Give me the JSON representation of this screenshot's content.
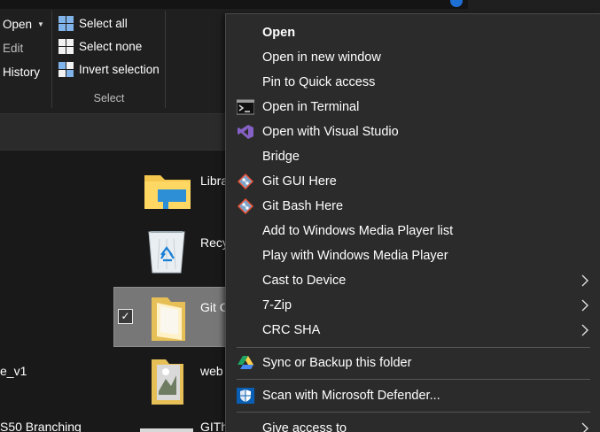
{
  "ribbon": {
    "open_label": "Open",
    "edit_label": "Edit",
    "history_label": "History",
    "select_all_label": "Select all",
    "select_none_label": "Select none",
    "invert_selection_label": "Invert selection",
    "select_group_label": "Select"
  },
  "files": {
    "libraries_label": "Libra",
    "recycle_label": "Recy",
    "git_label": "Git C",
    "web_label": "web",
    "githu_label": "GITh",
    "left_v1_label": "e_v1",
    "left_branching_label": "S50 Branching",
    "git_selected": true
  },
  "context_menu": {
    "items": [
      {
        "label": "Open"
      },
      {
        "label": "Open in new window"
      },
      {
        "label": "Pin to Quick access"
      },
      {
        "label": "Open in Terminal",
        "icon": "terminal-icon"
      },
      {
        "label": "Open with Visual Studio",
        "icon": "visual-studio-icon"
      },
      {
        "label": "Bridge"
      },
      {
        "label": "Git GUI Here",
        "icon": "git-icon"
      },
      {
        "label": "Git Bash Here",
        "icon": "git-icon"
      },
      {
        "label": "Add to Windows Media Player list"
      },
      {
        "label": "Play with Windows Media Player"
      },
      {
        "label": "Cast to Device",
        "submenu": true
      },
      {
        "label": "7-Zip",
        "submenu": true
      },
      {
        "label": "CRC SHA",
        "submenu": true
      },
      {
        "label": "Sync or Backup this folder",
        "icon": "google-drive-icon"
      },
      {
        "label": "Scan with Microsoft Defender...",
        "icon": "defender-shield-icon"
      },
      {
        "label": "Give access to",
        "submenu": true
      }
    ]
  },
  "colors": {
    "menu_background": "#2b2b2b",
    "selection_highlight": "#777777",
    "accent_blue": "#1e6fd4"
  }
}
